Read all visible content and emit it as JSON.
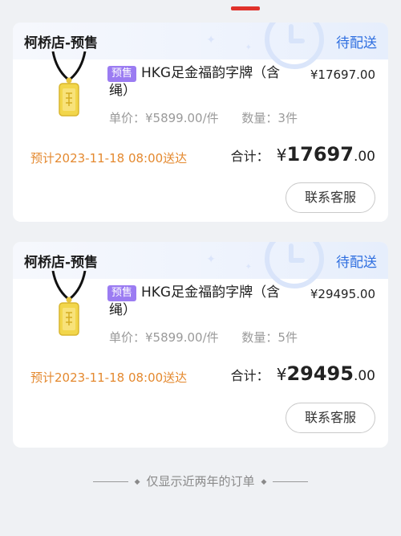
{
  "orders": [
    {
      "store": "柯桥店-预售",
      "status": "待配送",
      "badge": "预售",
      "title": "HKG足金福韵字牌（含绳）",
      "price": "¥17697.00",
      "unit_price": "单价：¥5899.00/件",
      "quantity": "数量：3件",
      "eta": "预计2023-11-18 08:00送达",
      "total_label": "合计：",
      "total_currency": "¥",
      "total_int": "17697",
      "total_dec": ".00",
      "contact_label": "联系客服"
    },
    {
      "store": "柯桥店-预售",
      "status": "待配送",
      "badge": "预售",
      "title": "HKG足金福韵字牌（含绳）",
      "price": "¥29495.00",
      "unit_price": "单价：¥5899.00/件",
      "quantity": "数量：5件",
      "eta": "预计2023-11-18 08:00送达",
      "total_label": "合计：",
      "total_currency": "¥",
      "total_int": "29495",
      "total_dec": ".00",
      "contact_label": "联系客服"
    }
  ],
  "footer": {
    "text": "仅显示近两年的订单"
  },
  "colors": {
    "status_blue": "#2f6fe0",
    "eta_orange": "#e4892f",
    "badge_purple": "#9b7cf2",
    "accent_red": "#e0322b"
  },
  "icons": {
    "decoration": "clock-icon",
    "product": "gold-pendant-icon"
  }
}
